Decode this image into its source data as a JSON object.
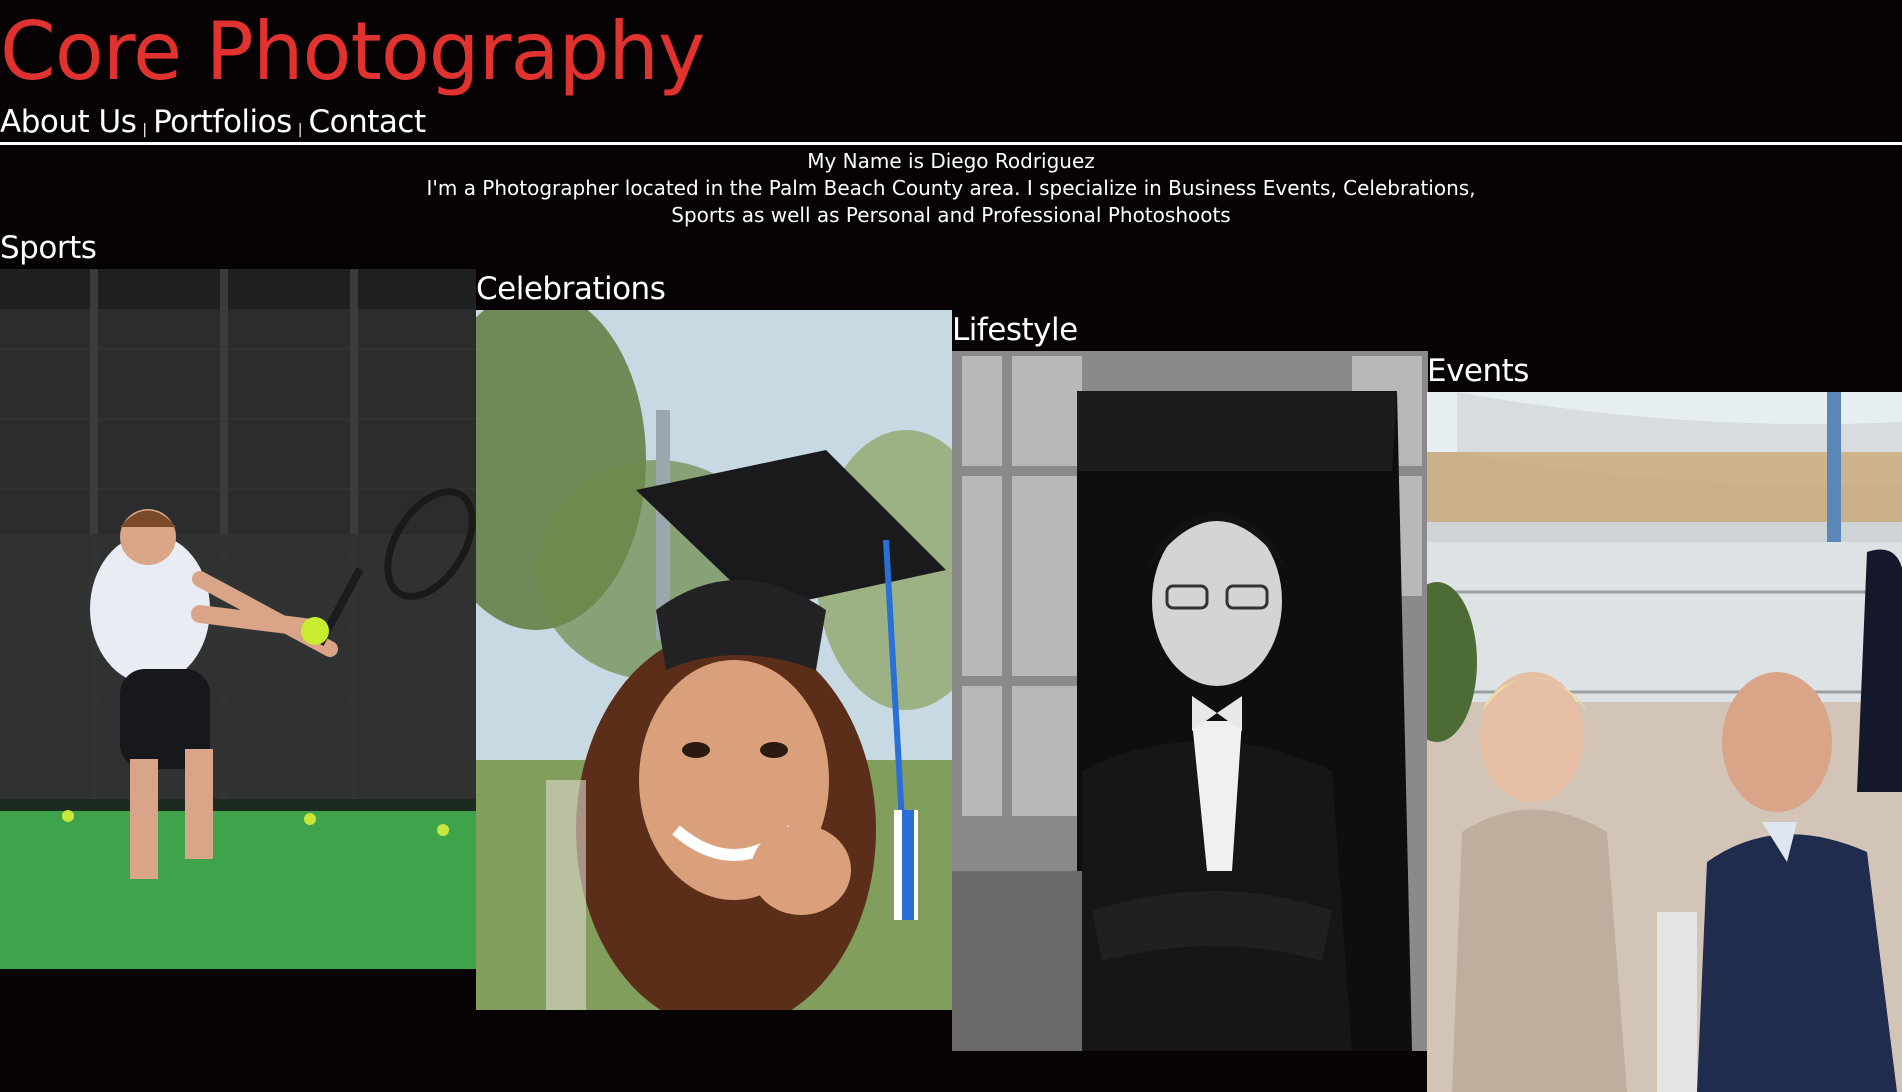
{
  "site": {
    "title": "Core Photography",
    "accent_color": "#e0322f",
    "background_color": "#070304"
  },
  "nav": {
    "items": [
      {
        "label": "About Us"
      },
      {
        "label": "Portfolios"
      },
      {
        "label": "Contact"
      }
    ],
    "separator": "|"
  },
  "intro": {
    "name_line": "My Name is Diego Rodriguez",
    "bio": "I'm a Photographer located in the Palm Beach County area. I specialize in Business Events, Celebrations, Sports as well as Personal and Professional Photoshoots"
  },
  "portfolios": [
    {
      "title": "Sports",
      "image": "tennis-player-photo"
    },
    {
      "title": "Celebrations",
      "image": "graduate-portrait-photo"
    },
    {
      "title": "Lifestyle",
      "image": "pianist-portrait-photo"
    },
    {
      "title": "Events",
      "image": "event-guests-photo"
    }
  ]
}
